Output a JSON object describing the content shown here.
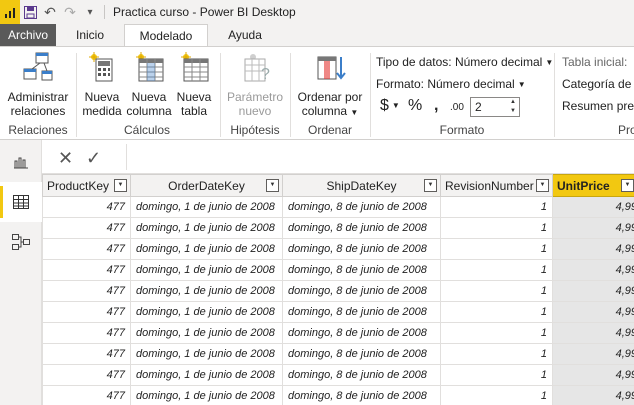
{
  "window": {
    "title": "Practica curso - Power BI Desktop"
  },
  "tabs": {
    "file": "Archivo",
    "home": "Inicio",
    "modeling": "Modelado",
    "help": "Ayuda"
  },
  "ribbon": {
    "manage_relationships": [
      "Administrar",
      "relaciones"
    ],
    "new_measure": [
      "Nueva",
      "medida"
    ],
    "new_column": [
      "Nueva",
      "columna"
    ],
    "new_table": [
      "Nueva",
      "tabla"
    ],
    "new_parameter": [
      "Parámetro",
      "nuevo"
    ],
    "sort_by_column": [
      "Ordenar por",
      "columna"
    ],
    "groups": {
      "relationships": "Relaciones",
      "calculations": "Cálculos",
      "whatif": "Hipótesis",
      "sort": "Ordenar",
      "formatting": "Formato",
      "properties": "Pro"
    },
    "formatting": {
      "data_type": "Tipo de datos: Número decimal",
      "format": "Formato: Número decimal",
      "currency_symbol": "$",
      "percent_symbol": "%",
      "comma_symbol": ",",
      "decimals_symbol": ".00",
      "decimal_places": "2"
    },
    "properties": {
      "home_table": "Tabla inicial:",
      "data_category": "Categoría de d",
      "summarization": "Resumen pred"
    }
  },
  "table": {
    "columns": [
      "ProductKey",
      "OrderDateKey",
      "ShipDateKey",
      "RevisionNumber",
      "UnitPrice"
    ],
    "selected_column": "UnitPrice",
    "rows": [
      [
        "477",
        "domingo, 1 de junio de 2008",
        "domingo, 8 de junio de 2008",
        "1",
        "4,99"
      ],
      [
        "477",
        "domingo, 1 de junio de 2008",
        "domingo, 8 de junio de 2008",
        "1",
        "4,99"
      ],
      [
        "477",
        "domingo, 1 de junio de 2008",
        "domingo, 8 de junio de 2008",
        "1",
        "4,99"
      ],
      [
        "477",
        "domingo, 1 de junio de 2008",
        "domingo, 8 de junio de 2008",
        "1",
        "4,99"
      ],
      [
        "477",
        "domingo, 1 de junio de 2008",
        "domingo, 8 de junio de 2008",
        "1",
        "4,99"
      ],
      [
        "477",
        "domingo, 1 de junio de 2008",
        "domingo, 8 de junio de 2008",
        "1",
        "4,99"
      ],
      [
        "477",
        "domingo, 1 de junio de 2008",
        "domingo, 8 de junio de 2008",
        "1",
        "4,99"
      ],
      [
        "477",
        "domingo, 1 de junio de 2008",
        "domingo, 8 de junio de 2008",
        "1",
        "4,99"
      ],
      [
        "477",
        "domingo, 1 de junio de 2008",
        "domingo, 8 de junio de 2008",
        "1",
        "4,99"
      ],
      [
        "477",
        "domingo, 1 de junio de 2008",
        "domingo, 8 de junio de 2008",
        "1",
        "4,99"
      ]
    ]
  },
  "colors": {
    "accent": "#f2c811",
    "file_tab": "#5a5a5a"
  }
}
